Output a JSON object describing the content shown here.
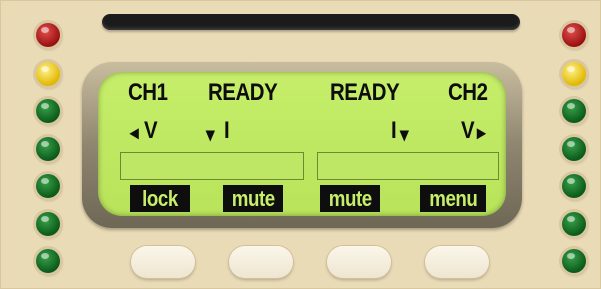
{
  "display": {
    "ch1": {
      "label": "CH1",
      "status": "READY",
      "left_arrow": "◂",
      "voltage": "V",
      "down_arrow": "▾",
      "current": "I"
    },
    "ch2": {
      "label": "CH2",
      "status": "READY",
      "current": "I",
      "down_arrow": "▾",
      "voltage": "V",
      "right_arrow": "▸"
    },
    "fields": {
      "ch1_value": "",
      "ch2_value": ""
    },
    "softkeys": {
      "key1": "lock",
      "key2": "mute",
      "key3": "mute",
      "key4": "menu"
    }
  },
  "leds": {
    "left": [
      "red",
      "yellow",
      "green",
      "green",
      "green",
      "green",
      "green"
    ],
    "right": [
      "red",
      "yellow",
      "green",
      "green",
      "green",
      "green",
      "green"
    ]
  },
  "colors": {
    "panel": "#eadbb7",
    "lcd": "#c6ee6a",
    "lcd_text": "#0d0d0d",
    "led_red": "#9a1010",
    "led_yellow": "#e0b800",
    "led_green": "#0b5a1a"
  }
}
